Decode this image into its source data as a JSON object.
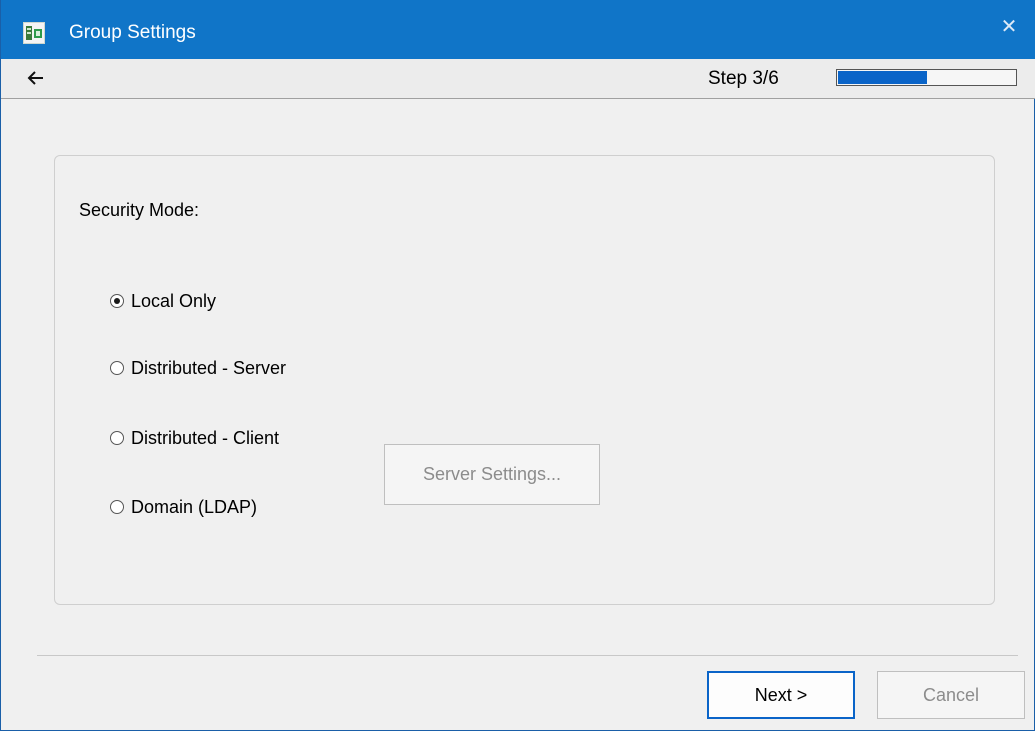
{
  "window": {
    "title": "Group Settings",
    "icons": {
      "app": "app-logo-icon",
      "close": "close-icon",
      "back": "back-arrow-icon"
    },
    "colors": {
      "titlebar": "#1075c8",
      "accent": "#0a64c8"
    }
  },
  "nav": {
    "step_label": "Step 3/6",
    "progress_fraction": 0.5
  },
  "panel": {
    "security_label": "Security Mode:",
    "options": [
      {
        "label": "Local Only",
        "selected": true
      },
      {
        "label": "Distributed - Server",
        "selected": false
      },
      {
        "label": "Distributed - Client",
        "selected": false
      },
      {
        "label": "Domain (LDAP)",
        "selected": false
      }
    ],
    "server_settings_label": "Server Settings...",
    "server_settings_enabled": false
  },
  "footer": {
    "next_label": "Next >",
    "cancel_label": "Cancel",
    "cancel_enabled": false
  }
}
